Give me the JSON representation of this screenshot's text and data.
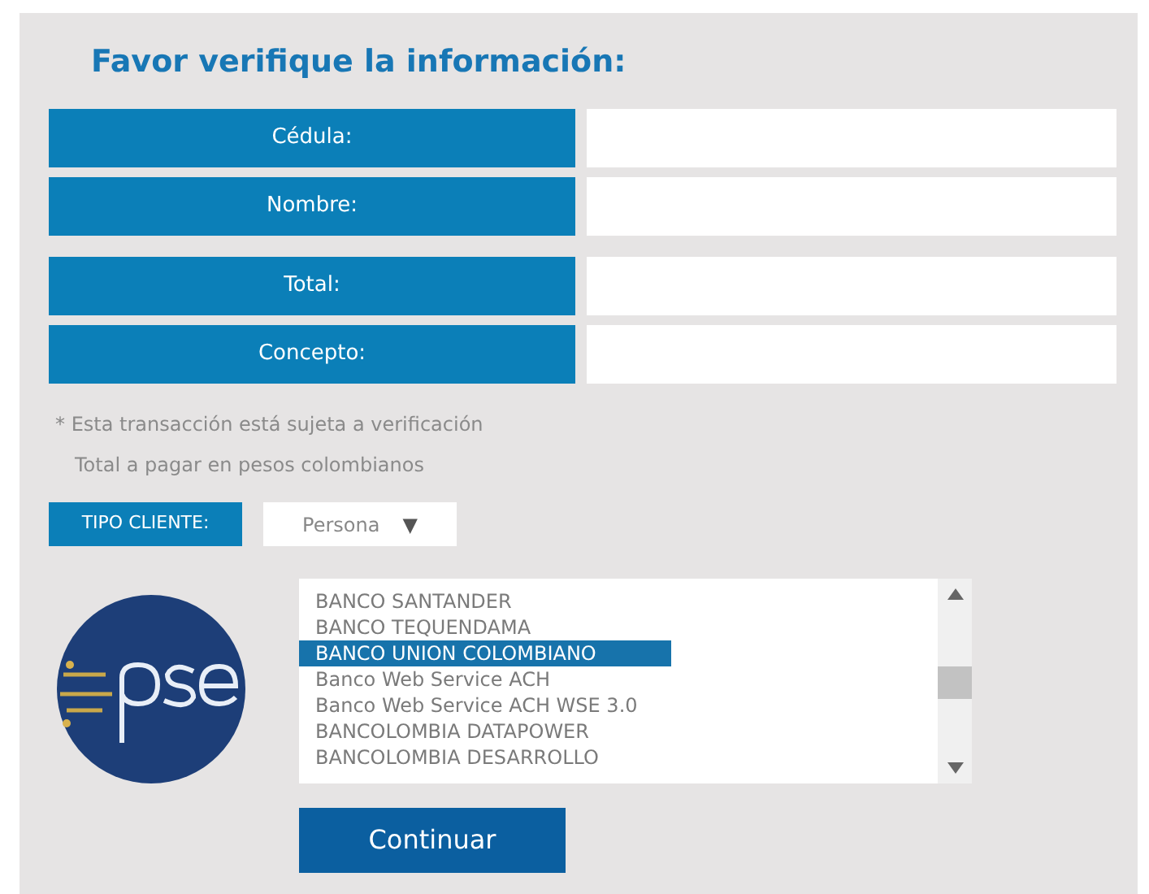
{
  "title": "Favor verifique la información:",
  "field_groups": [
    [
      {
        "label": "Cédula:"
      },
      {
        "label": "Nombre:"
      }
    ],
    [
      {
        "label": "Total:"
      },
      {
        "label": "Concepto:"
      }
    ]
  ],
  "notes": [
    "* Esta transacción está sujeta a verificación",
    "Total a pagar en pesos colombianos"
  ],
  "client_type": {
    "label": "TIPO CLIENTE:",
    "value": "Persona",
    "arrow": "▼"
  },
  "banks": [
    {
      "name": "BANCO SANTANDER",
      "selected": false
    },
    {
      "name": "BANCO TEQUENDAMA",
      "selected": false
    },
    {
      "name": "BANCO UNION COLOMBIANO",
      "selected": true
    },
    {
      "name": "Banco Web Service ACH",
      "selected": false
    },
    {
      "name": "Banco Web Service ACH WSE 3.0",
      "selected": false
    },
    {
      "name": "BANCOLOMBIA DATAPOWER",
      "selected": false
    },
    {
      "name": "BANCOLOMBIA DESARROLLO",
      "selected": false
    }
  ],
  "continue_button": "Continuar"
}
